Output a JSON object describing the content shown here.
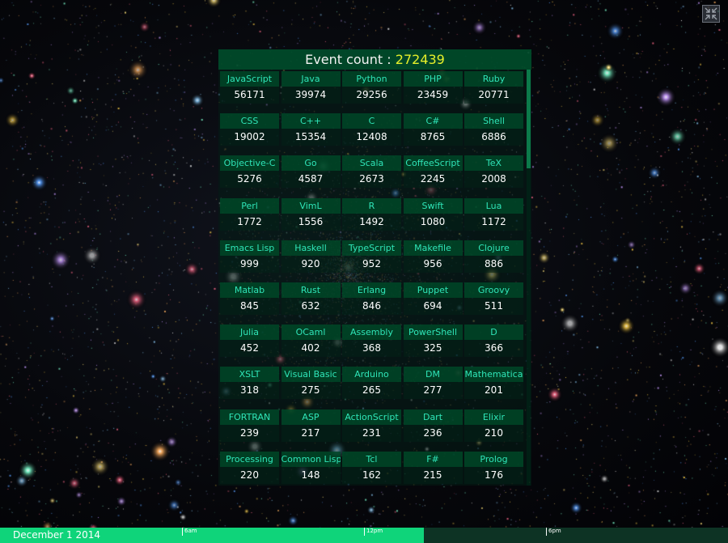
{
  "header": {
    "label": "Event count :",
    "count": "272439"
  },
  "languages": [
    [
      {
        "name": "JavaScript",
        "count": "56171"
      },
      {
        "name": "Java",
        "count": "39974"
      },
      {
        "name": "Python",
        "count": "29256"
      },
      {
        "name": "PHP",
        "count": "23459"
      },
      {
        "name": "Ruby",
        "count": "20771"
      }
    ],
    [
      {
        "name": "CSS",
        "count": "19002"
      },
      {
        "name": "C++",
        "count": "15354"
      },
      {
        "name": "C",
        "count": "12408"
      },
      {
        "name": "C#",
        "count": "8765"
      },
      {
        "name": "Shell",
        "count": "6886"
      }
    ],
    [
      {
        "name": "Objective-C",
        "count": "5276"
      },
      {
        "name": "Go",
        "count": "4587"
      },
      {
        "name": "Scala",
        "count": "2673"
      },
      {
        "name": "CoffeeScript",
        "count": "2245"
      },
      {
        "name": "TeX",
        "count": "2008"
      }
    ],
    [
      {
        "name": "Perl",
        "count": "1772"
      },
      {
        "name": "VimL",
        "count": "1556"
      },
      {
        "name": "R",
        "count": "1492"
      },
      {
        "name": "Swift",
        "count": "1080"
      },
      {
        "name": "Lua",
        "count": "1172"
      }
    ],
    [
      {
        "name": "Emacs Lisp",
        "count": "999"
      },
      {
        "name": "Haskell",
        "count": "920"
      },
      {
        "name": "TypeScript",
        "count": "952"
      },
      {
        "name": "Makefile",
        "count": "956"
      },
      {
        "name": "Clojure",
        "count": "886"
      }
    ],
    [
      {
        "name": "Matlab",
        "count": "845"
      },
      {
        "name": "Rust",
        "count": "632"
      },
      {
        "name": "Erlang",
        "count": "846"
      },
      {
        "name": "Puppet",
        "count": "694"
      },
      {
        "name": "Groovy",
        "count": "511"
      }
    ],
    [
      {
        "name": "Julia",
        "count": "452"
      },
      {
        "name": "OCaml",
        "count": "402"
      },
      {
        "name": "Assembly",
        "count": "368"
      },
      {
        "name": "PowerShell",
        "count": "325"
      },
      {
        "name": "D",
        "count": "366"
      }
    ],
    [
      {
        "name": "XSLT",
        "count": "318"
      },
      {
        "name": "Visual Basic",
        "count": "275"
      },
      {
        "name": "Arduino",
        "count": "265"
      },
      {
        "name": "DM",
        "count": "277"
      },
      {
        "name": "Mathematica",
        "count": "201"
      }
    ],
    [
      {
        "name": "FORTRAN",
        "count": "239"
      },
      {
        "name": "ASP",
        "count": "217"
      },
      {
        "name": "ActionScript",
        "count": "231"
      },
      {
        "name": "Dart",
        "count": "236"
      },
      {
        "name": "Elixir",
        "count": "210"
      }
    ],
    [
      {
        "name": "Processing",
        "count": "220"
      },
      {
        "name": "Common Lisp",
        "count": "148"
      },
      {
        "name": "Tcl",
        "count": "162"
      },
      {
        "name": "F#",
        "count": "215"
      },
      {
        "name": "Prolog",
        "count": "176"
      }
    ]
  ],
  "timeline": {
    "date": "December 1 2014",
    "progress": 0.582,
    "ticks": [
      {
        "label": "6am",
        "position": 0.25
      },
      {
        "label": "12pm",
        "position": 0.5
      },
      {
        "label": "6pm",
        "position": 0.75
      }
    ]
  },
  "icons": {
    "fullscreen": "fullscreen-exit-icon"
  },
  "colors": {
    "header_bg": "#00502d",
    "lang_text": "#2fe5b8",
    "count_highlight": "#e6f02a",
    "timeline_progress": "#0fd47a",
    "timeline_track": "#0d3324"
  }
}
